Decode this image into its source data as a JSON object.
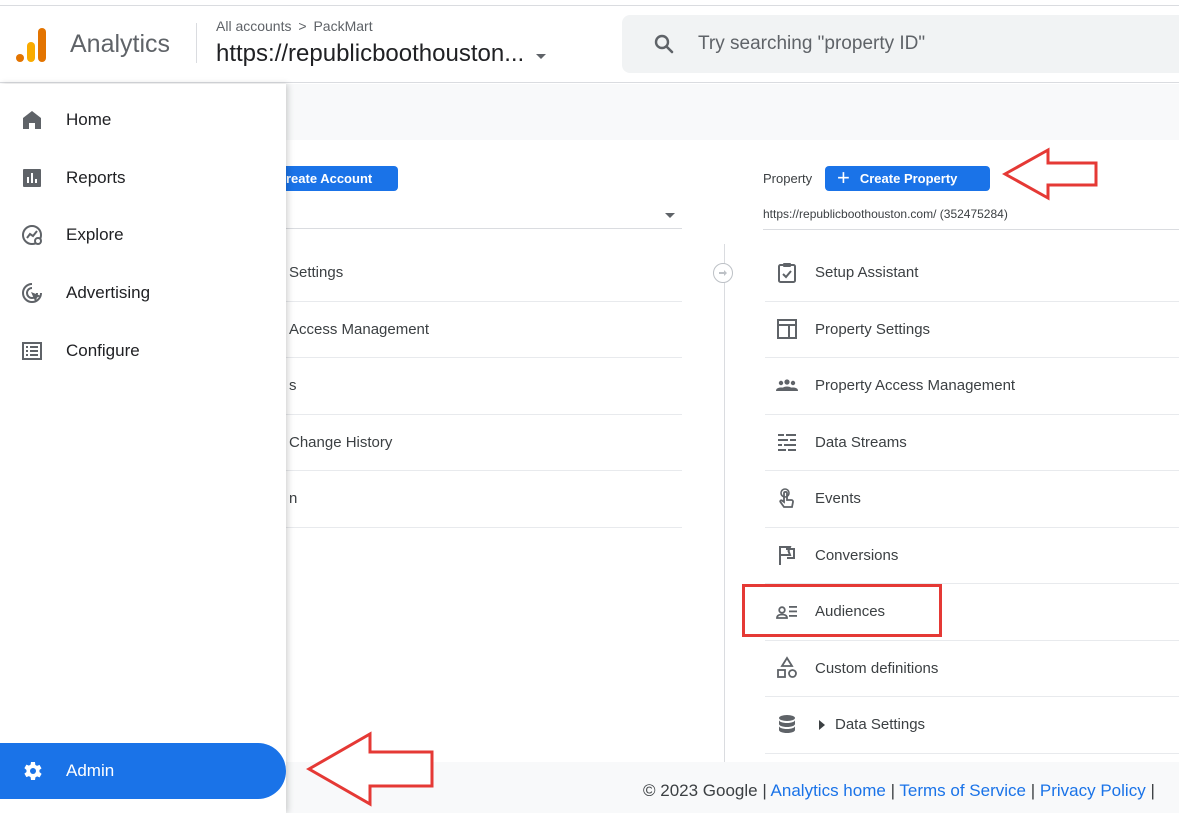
{
  "header": {
    "app_name": "Analytics",
    "breadcrumb_root": "All accounts",
    "breadcrumb_sep": ">",
    "breadcrumb_account": "PackMart",
    "property_name": "https://republicboothouston...",
    "search_placeholder": "Try searching \"property ID\""
  },
  "account": {
    "create_label": "reate Account",
    "items": [
      {
        "label": "Settings"
      },
      {
        "label": "Access Management"
      },
      {
        "label": "s"
      },
      {
        "label": "Change History"
      },
      {
        "label": "n"
      }
    ]
  },
  "property": {
    "label": "Property",
    "create_label": "Create Property",
    "url": "https://republicboothouston.com/ (352475284)",
    "items": [
      {
        "label": "Setup Assistant",
        "icon": "clipboard-check-icon"
      },
      {
        "label": "Property Settings",
        "icon": "layout-icon"
      },
      {
        "label": "Property Access Management",
        "icon": "people-icon"
      },
      {
        "label": "Data Streams",
        "icon": "streams-icon"
      },
      {
        "label": "Events",
        "icon": "touch-icon"
      },
      {
        "label": "Conversions",
        "icon": "flag-icon"
      },
      {
        "label": "Audiences",
        "icon": "audience-icon"
      },
      {
        "label": "Custom definitions",
        "icon": "shapes-icon"
      },
      {
        "label": "Data Settings",
        "icon": "database-icon"
      }
    ]
  },
  "sidebar": {
    "items": [
      {
        "label": "Home",
        "icon": "home-icon"
      },
      {
        "label": "Reports",
        "icon": "bar-chart-icon"
      },
      {
        "label": "Explore",
        "icon": "explore-icon"
      },
      {
        "label": "Advertising",
        "icon": "cursor-icon"
      },
      {
        "label": "Configure",
        "icon": "list-icon"
      }
    ],
    "admin_label": "Admin"
  },
  "footer": {
    "copyright": "© 2023 Google |",
    "analytics_home": "Analytics home",
    "sep1": "|",
    "terms": "Terms of Service",
    "sep2": "|",
    "privacy": "Privacy Policy",
    "sep3": "|"
  },
  "colors": {
    "accent": "#1a73e8",
    "annotation": "#e53935"
  }
}
